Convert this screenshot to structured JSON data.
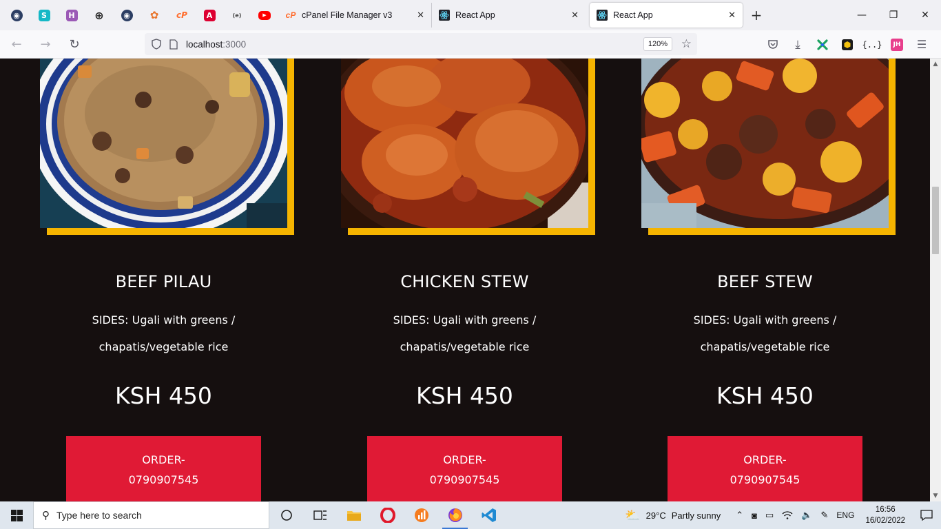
{
  "browser": {
    "pinned_tabs": [
      {
        "icon": "github-icon",
        "color": "#24292f",
        "glyph": "◉"
      },
      {
        "icon": "s-app-icon",
        "color": "#15b8a6",
        "glyph": "S"
      },
      {
        "icon": "h-app-icon",
        "color": "#8e44ad",
        "glyph": "H"
      },
      {
        "icon": "globe-icon",
        "color": "#333333",
        "glyph": "⊕"
      },
      {
        "icon": "github-icon",
        "color": "#24292f",
        "glyph": "◉"
      },
      {
        "icon": "figma-icon",
        "color": "#f24e1e",
        "glyph": "✿"
      },
      {
        "icon": "cpanel-icon",
        "color": "#ff6c2c",
        "glyph": "cP"
      },
      {
        "icon": "angular-icon",
        "color": "#dd0031",
        "glyph": "A"
      },
      {
        "icon": "dev-icon",
        "color": "#444444",
        "glyph": "{e}"
      },
      {
        "icon": "youtube-icon",
        "color": "#ff0000",
        "glyph": "▶"
      }
    ],
    "tabs": [
      {
        "label": "cPanel File Manager v3",
        "icon": "cpanel-icon"
      },
      {
        "label": "React App",
        "icon": "react-icon"
      },
      {
        "label": "React App",
        "icon": "react-icon",
        "active": true
      }
    ],
    "url_host": "localhost",
    "url_port": ":3000",
    "zoom": "120%"
  },
  "menu": [
    {
      "name": "BEEF PILAU",
      "sides_line1": "SIDES: Ugali with greens /",
      "sides_line2": "chapatis/vegetable rice",
      "price": "KSH 450",
      "order_line1": "ORDER-",
      "order_line2": "0790907545"
    },
    {
      "name": "CHICKEN STEW",
      "sides_line1": "SIDES: Ugali with greens /",
      "sides_line2": "chapatis/vegetable rice",
      "price": "KSH 450",
      "order_line1": "ORDER-",
      "order_line2": "0790907545"
    },
    {
      "name": "BEEF STEW",
      "sides_line1": "SIDES: Ugali with greens /",
      "sides_line2": "chapatis/vegetable rice",
      "price": "KSH 450",
      "order_line1": "ORDER-",
      "order_line2": "0790907545"
    }
  ],
  "colors": {
    "page_bg": "#150f0f",
    "accent_frame": "#f5b400",
    "order_button": "#e01a35"
  },
  "taskbar": {
    "search_placeholder": "Type here to search",
    "weather_temp": "29°C",
    "weather_text": "Partly sunny",
    "language": "ENG",
    "time": "16:56",
    "date": "16/02/2022"
  }
}
